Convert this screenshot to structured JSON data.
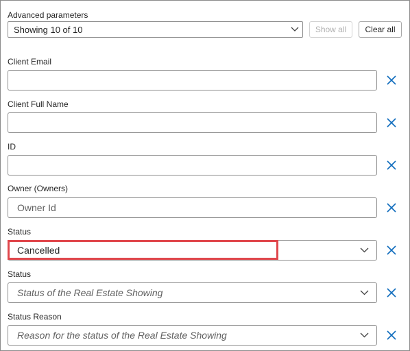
{
  "header": {
    "title": "Advanced parameters",
    "showing": "Showing 10 of 10",
    "show_all_label": "Show all",
    "clear_all_label": "Clear all"
  },
  "fields": [
    {
      "label": "Client Email",
      "value": "",
      "placeholder": ""
    },
    {
      "label": "Client Full Name",
      "value": "",
      "placeholder": ""
    },
    {
      "label": "ID",
      "value": "",
      "placeholder": ""
    },
    {
      "label": "Owner (Owners)",
      "value": "",
      "placeholder": "Owner Id"
    },
    {
      "label": "Status",
      "value": "Cancelled",
      "placeholder": ""
    },
    {
      "label": "Status",
      "value": "",
      "placeholder": "Status of the Real Estate Showing"
    },
    {
      "label": "Status Reason",
      "value": "",
      "placeholder": "Reason for the status of the Real Estate Showing"
    }
  ],
  "colors": {
    "accent": "#0f6cbd",
    "highlight": "#e0474c"
  },
  "icons": {
    "dropdown": "chevron-down-icon",
    "remove": "close-icon"
  }
}
